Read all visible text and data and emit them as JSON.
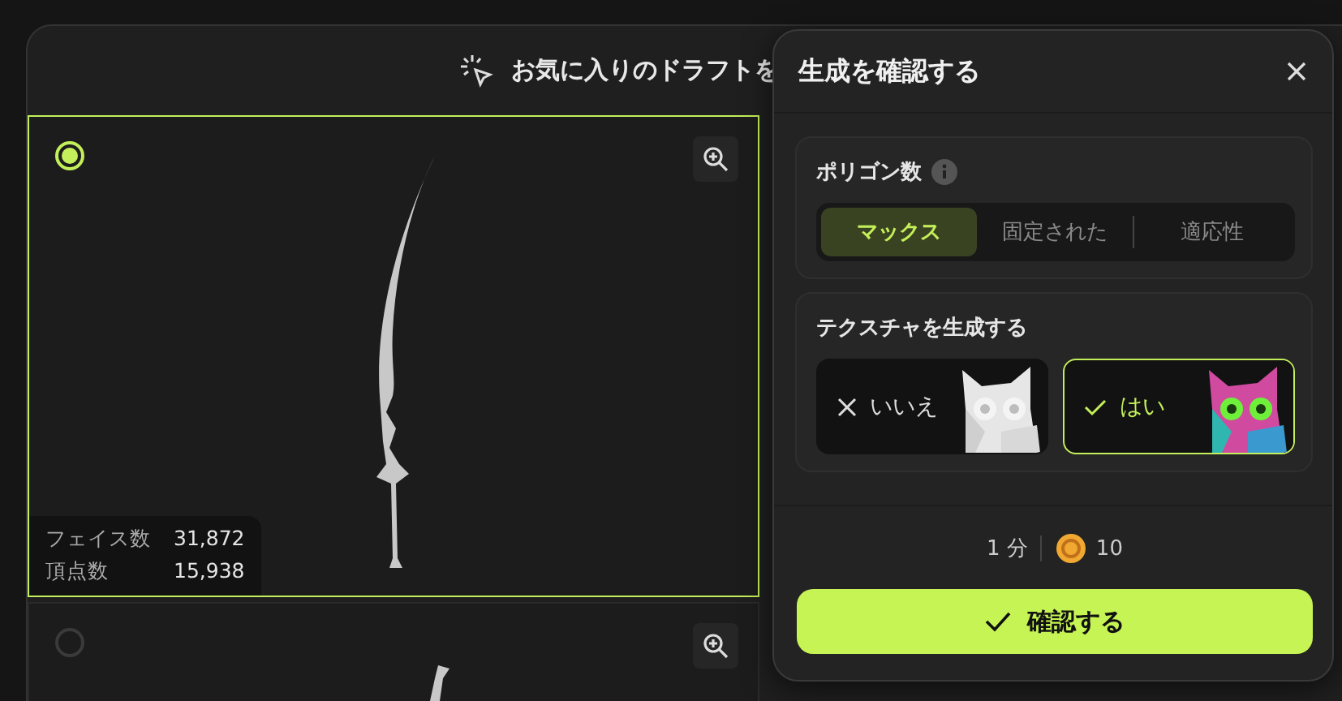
{
  "background_panel": {
    "title": "お気に入りのドラフトを"
  },
  "drafts": [
    {
      "selected": true,
      "stats": [
        {
          "label": "フェイス数",
          "value": "31,872"
        },
        {
          "label": "頂点数",
          "value": "15,938"
        }
      ]
    },
    {
      "selected": false
    }
  ],
  "dialog": {
    "title": "生成を確認する",
    "polygon": {
      "label": "ポリゴン数",
      "options": [
        {
          "label": "マックス",
          "selected": true
        },
        {
          "label": "固定された",
          "selected": false
        },
        {
          "label": "適応性",
          "selected": false
        }
      ]
    },
    "texture": {
      "label": "テクスチャを生成する",
      "options": [
        {
          "kind": "no",
          "label": "いいえ",
          "selected": false
        },
        {
          "kind": "yes",
          "label": "はい",
          "selected": true
        }
      ]
    },
    "time": "1 分",
    "credits": "10",
    "confirm": "確認する"
  }
}
